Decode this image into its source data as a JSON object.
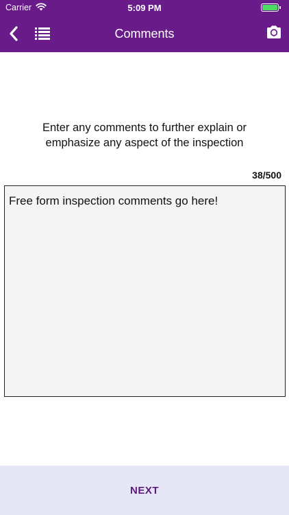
{
  "status_bar": {
    "carrier": "Carrier",
    "time": "5:09 PM",
    "battery_color": "#4cd964"
  },
  "nav": {
    "title": "Comments",
    "back_icon": "chevron-left-icon",
    "list_icon": "list-icon",
    "camera_icon": "camera-icon",
    "background_color": "#6a1b8a"
  },
  "main": {
    "prompt": "Enter any comments to further explain or emphasize any aspect of the inspection",
    "counter": "38/500",
    "comment_value": "Free form inspection comments go here!"
  },
  "footer": {
    "next_label": "NEXT",
    "background_color": "#e6e6f7",
    "label_color": "#5c1a7e"
  }
}
